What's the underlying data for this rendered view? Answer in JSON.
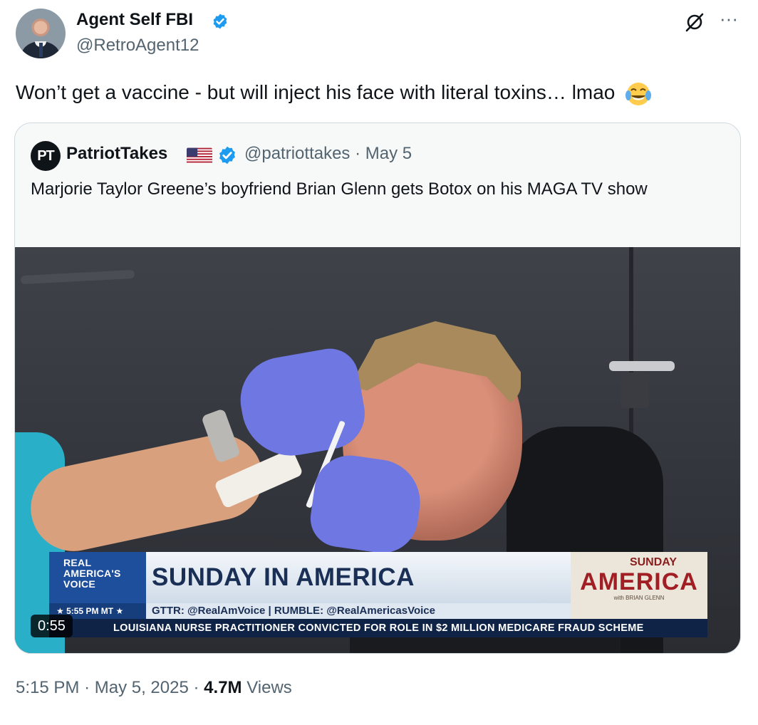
{
  "tweet": {
    "author_name": "Agent Self FBI",
    "author_handle": "@RetroAgent12",
    "text": "Won’t get a vaccine - but will inject his face with literal toxins… lmao",
    "emoji": "face-with-tears-of-joy",
    "time": "5:15 PM",
    "separator": "·",
    "date": "May 5, 2025",
    "views_count": "4.7M",
    "views_label": "Views"
  },
  "quoted": {
    "avatar_initials": "PT",
    "author_name": "PatriotTakes",
    "author_handle": "@patriottakes",
    "separator": "·",
    "date": "May 5",
    "text": "Marjorie Taylor Greene’s boyfriend Brian Glenn gets Botox on his MAGA TV show",
    "video": {
      "duration": "0:55",
      "brand_line1": "REAL",
      "brand_line2": "AMERICA'S",
      "brand_line3": "VOICE",
      "time_strip": "★ 5:55 PM MT ★",
      "headline": "SUNDAY IN AMERICA",
      "social_strip": "GTTR: @RealAmVoice | RUMBLE: @RealAmericasVoice",
      "show_logo_top": "SUNDAY",
      "show_logo_main": "AMERICA",
      "show_logo_small": "with BRIAN GLENN",
      "ticker": "LOUISIANA NURSE PRACTITIONER CONVICTED FOR ROLE IN $2 MILLION MEDICARE FRAUD SCHEME"
    }
  },
  "colors": {
    "verified_blue": "#1d9bf0",
    "secondary_text": "#536471",
    "primary_text": "#0f1419",
    "border": "#cfd9de"
  },
  "icons": {
    "grok": "grok-icon",
    "more": "more-icon",
    "verified": "verified-badge-icon",
    "flag": "us-flag-icon"
  }
}
